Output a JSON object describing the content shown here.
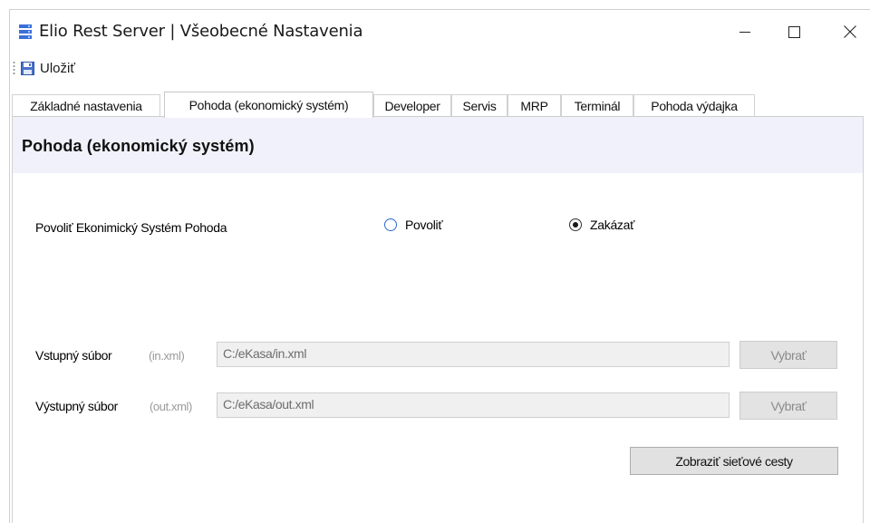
{
  "window": {
    "title": "Elio Rest Server | Všeobecné Nastavenia",
    "controls": {
      "minimize": "minimize",
      "maximize": "maximize",
      "close": "close"
    }
  },
  "toolbar": {
    "save_label": "Uložiť"
  },
  "tabs": [
    {
      "label": "Základné nastavenia",
      "active": false
    },
    {
      "label": "Pohoda (ekonomický systém)",
      "active": true
    },
    {
      "label": "Developer",
      "active": false
    },
    {
      "label": "Servis",
      "active": false
    },
    {
      "label": "MRP",
      "active": false
    },
    {
      "label": "Terminál",
      "active": false
    },
    {
      "label": "Pohoda výdajka",
      "active": false
    }
  ],
  "panel": {
    "title": "Pohoda (ekonomický systém)",
    "enable_label": "Povoliť Ekonimický Systém Pohoda",
    "radio_allow": {
      "label": "Povoliť",
      "checked": false
    },
    "radio_deny": {
      "label": "Zakázať",
      "checked": true
    },
    "input_row": {
      "label": "Vstupný súbor",
      "hint": "(in.xml)",
      "value": "C:/eKasa/in.xml",
      "button": "Vybrať"
    },
    "output_row": {
      "label": "Výstupný súbor",
      "hint": "(out.xml)",
      "value": "C:/eKasa/out.xml",
      "button": "Vybrať"
    },
    "network_button": "Zobraziť sieťové cesty"
  },
  "colors": {
    "header_bg": "#f1f1fb",
    "radio_accent": "#2d6bd1",
    "disabled_field_bg": "#f0f0f0",
    "disabled_text": "#8a8a8a",
    "icon_blue": "#3a6fd8"
  }
}
